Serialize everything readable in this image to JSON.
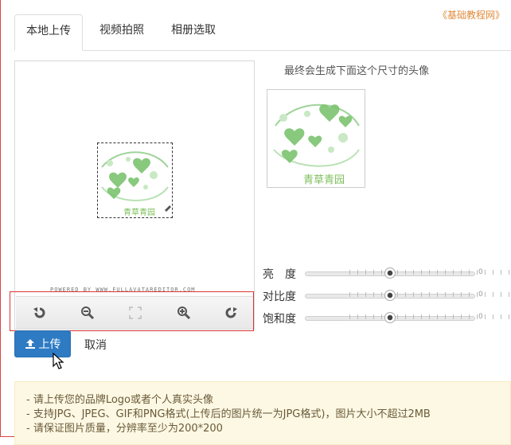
{
  "watermark": "《基础教程网》",
  "tabs": [
    {
      "label": "本地上传",
      "active": true
    },
    {
      "label": "视频拍照",
      "active": false
    },
    {
      "label": "相册选取",
      "active": false
    }
  ],
  "preview": {
    "logo_text": "青草青园",
    "powered_text": "POWERED BY WWW.FULLAVATAREDITOR.COM"
  },
  "toolbar": {
    "tools": [
      "rotate-left-icon",
      "zoom-out-icon",
      "fit-icon",
      "zoom-in-icon",
      "rotate-right-icon"
    ]
  },
  "result": {
    "label": "最终会生成下面这个尺寸的头像",
    "logo_text": "青草青园"
  },
  "sliders": [
    {
      "label": "亮　度",
      "value": "0",
      "position": 0.5
    },
    {
      "label": "对比度",
      "value": "0",
      "position": 0.5
    },
    {
      "label": "饱和度",
      "value": "0",
      "position": 0.5
    }
  ],
  "buttons": {
    "upload": "上传",
    "cancel": "取消"
  },
  "tips": [
    "- 请上传您的品牌Logo或者个人真实头像",
    "- 支持JPG、JPEG、GIF和PNG格式(上传后的图片统一为JPG格式)，图片大小不超过2MB",
    "- 请保证图片质量，分辨率至少为200*200"
  ],
  "colors": {
    "accent": "#2e7bc4",
    "highlight": "#dd3333",
    "tips_bg": "#fcf8e3",
    "watermark": "#e08a3a"
  }
}
